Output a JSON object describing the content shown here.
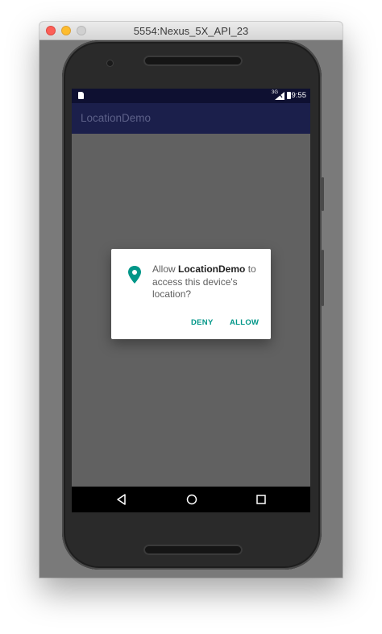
{
  "window": {
    "title": "5554:Nexus_5X_API_23"
  },
  "status_bar": {
    "network": "3G",
    "time": "9:55"
  },
  "app_bar": {
    "title": "LocationDemo"
  },
  "dialog": {
    "prefix": "Allow ",
    "app_name": "LocationDemo",
    "suffix": " to access this device's location?",
    "deny_label": "DENY",
    "allow_label": "ALLOW",
    "accent_color": "#009688"
  },
  "nav_bar": {
    "icons": [
      "back-icon",
      "home-icon",
      "recents-icon"
    ]
  }
}
